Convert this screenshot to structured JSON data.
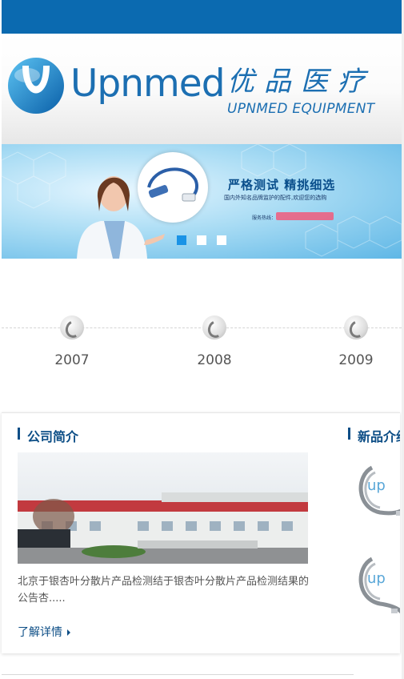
{
  "header": {
    "logo_en": "Upnmed",
    "logo_cn": "优品医疗",
    "logo_sub": "UPNMED  EQUIPMENT",
    "brand_color": "#1c6fb2",
    "topbar_color": "#0b6ab0"
  },
  "banner": {
    "title": "严格测试 精挑细选",
    "subtitle": "国内外知名品牌监护的配件,欢迎您的选购",
    "hotline_label": "服务热线：",
    "slides": 3,
    "active_slide": 1
  },
  "timeline": {
    "years": [
      "2007",
      "2008",
      "2009"
    ]
  },
  "about": {
    "title": "公司简介",
    "text": "北京于银杏叶分散片产品检测结于银杏叶分散片产品检测结果的公告杏.....",
    "more_label": "了解详情"
  },
  "new_products": {
    "title": "新品介绍"
  }
}
